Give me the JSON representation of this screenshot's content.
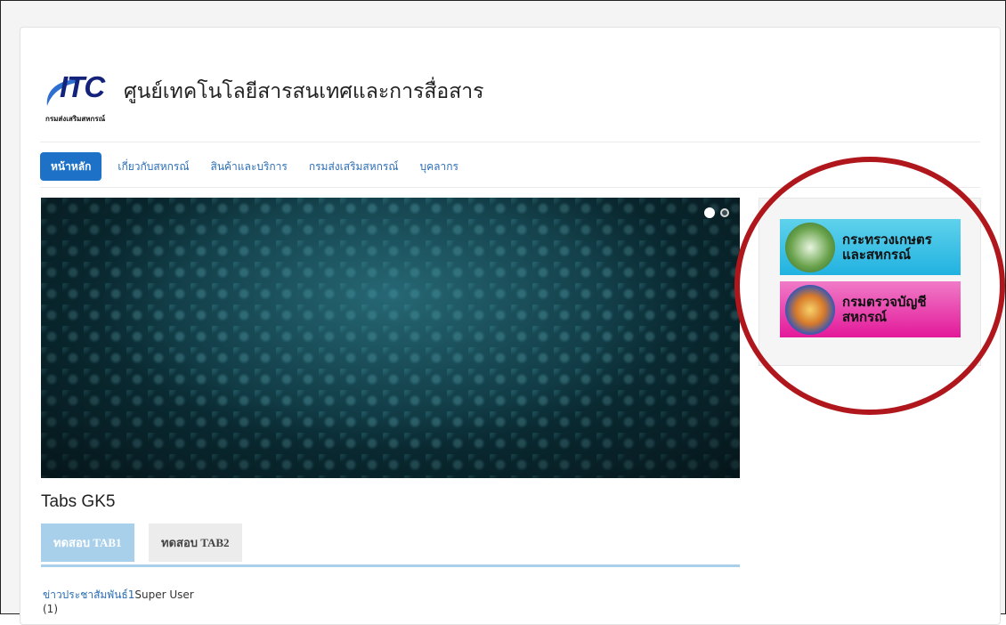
{
  "logo": {
    "mark": "ITC",
    "title": "ศูนย์เทคโนโลยีสารสนเทศและการสื่อสาร",
    "subtitle": "กรมส่งเสริมสหกรณ์",
    "swoosh_color": "#2f6fd0"
  },
  "nav": {
    "items": [
      {
        "label": "หน้าหลัก",
        "active": true
      },
      {
        "label": "เกี่ยวกับสหกรณ์"
      },
      {
        "label": "สินค้าและบริการ"
      },
      {
        "label": "กรมส่งเสริมสหกรณ์"
      },
      {
        "label": "บุคลากร"
      }
    ]
  },
  "slider": {
    "dots": [
      {
        "state": "active"
      },
      {
        "state": "inactive"
      }
    ],
    "background_color": "#0b2f38"
  },
  "sidebar": {
    "banners": [
      {
        "line1": "กระทรวงเกษตร",
        "line2": "และสหกรณ์",
        "color": "#21b2e0"
      },
      {
        "line1": "กรมตรวจบัญชี",
        "line2": "สหกรณ์",
        "color": "#e3199a"
      }
    ]
  },
  "tabs_module": {
    "title": "Tabs GK5",
    "tabs": [
      {
        "label": "ทดสอบ TAB1",
        "active": true
      },
      {
        "label": "ทดสอบ TAB2"
      }
    ],
    "news": {
      "link": "ข่าวประชาสัมพันธ์1",
      "author": "Super User",
      "count": "(1)"
    }
  },
  "annotation": {
    "color": "#b0171c",
    "shape": "circle"
  }
}
